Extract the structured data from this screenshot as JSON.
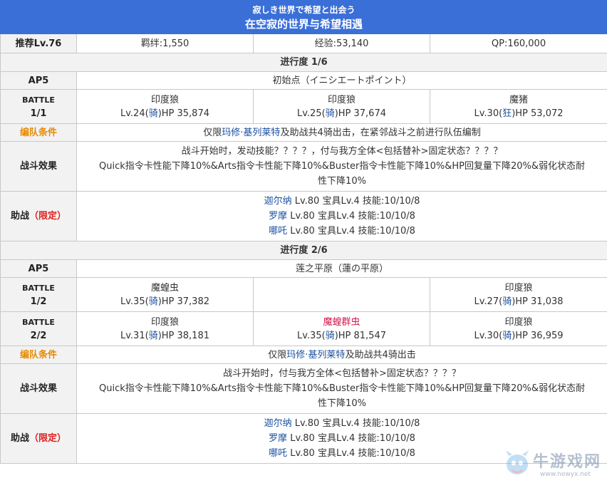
{
  "header": {
    "jp_title": "寂しき世界で希望と出会う",
    "cn_title": "在空寂的世界与希望相遇"
  },
  "summary": {
    "level": "推荐Lv.76",
    "bond": "羁绊:1,550",
    "exp": "经验:53,140",
    "qp": "QP:160,000"
  },
  "sections": [
    {
      "progress": "进行度 1/6",
      "ap": "AP5",
      "location": "初始点（イニシエートポイント）",
      "battles": [
        {
          "label1": "BATTLE",
          "label2": "1/1",
          "enemies": [
            {
              "name": "印度狼",
              "lv": "Lv.24(",
              "cls": "骑",
              "hp": ")HP 35,874"
            },
            {
              "name": "印度狼",
              "lv": "Lv.25(",
              "cls": "骑",
              "hp": ")HP 37,674"
            },
            {
              "name": "魔猪",
              "lv": "Lv.30(",
              "cls": "狂",
              "hp": ")HP 53,072"
            }
          ]
        }
      ],
      "formation": {
        "label": "编队条件",
        "pre": "仅限",
        "servant": "玛修·基列莱特",
        "post": "及助战共4骑出击，在紧邻战斗之前进行队伍编制"
      },
      "effect": {
        "label": "战斗效果",
        "line1": "战斗开始时，发动技能？？？？，付与我方全体<包括替补>固定状态？？？？",
        "line2": "Quick指令卡性能下降10%&Arts指令卡性能下降10%&Buster指令卡性能下降10%&HP回复量下降20%&弱化状态耐",
        "line3": "性下降10%"
      },
      "support": {
        "label": "助战",
        "tag": "（限定）",
        "items": [
          {
            "name": "迦尔纳",
            "info": " Lv.80 宝具Lv.4 技能:10/10/8"
          },
          {
            "name": "罗摩",
            "info": " Lv.80 宝具Lv.4 技能:10/10/8"
          },
          {
            "name": "哪吒",
            "info": " Lv.80 宝具Lv.4 技能:10/10/8"
          }
        ]
      }
    },
    {
      "progress": "进行度 2/6",
      "ap": "AP5",
      "location": "莲之平原（蓮の平原）",
      "battles": [
        {
          "label1": "BATTLE",
          "label2": "1/2",
          "enemies": [
            {
              "name": "魔蝗虫",
              "lv": "Lv.35(",
              "cls": "骑",
              "hp": ")HP 37,382"
            },
            {
              "name": "",
              "lv": "",
              "cls": "",
              "hp": ""
            },
            {
              "name": "印度狼",
              "lv": "Lv.27(",
              "cls": "骑",
              "hp": ")HP 31,038"
            }
          ]
        },
        {
          "label1": "BATTLE",
          "label2": "2/2",
          "enemies": [
            {
              "name": "印度狼",
              "lv": "Lv.31(",
              "cls": "骑",
              "hp": ")HP 38,181"
            },
            {
              "name": "魔蝗群虫",
              "lv": "Lv.35(",
              "cls": "骑",
              "hp": ")HP 81,547"
            },
            {
              "name": "印度狼",
              "lv": "Lv.30(",
              "cls": "骑",
              "hp": ")HP 36,959"
            }
          ]
        }
      ],
      "formation": {
        "label": "编队条件",
        "pre": "仅限",
        "servant": "玛修·基列莱特",
        "post": "及助战共4骑出击"
      },
      "effect": {
        "label": "战斗效果",
        "line1": "战斗开始时，付与我方全体<包括替补>固定状态？？？？",
        "line2": "Quick指令卡性能下降10%&Arts指令卡性能下降10%&Buster指令卡性能下降10%&HP回复量下降20%&弱化状态耐",
        "line3": "性下降10%"
      },
      "support": {
        "label": "助战",
        "tag": "（限定）",
        "items": [
          {
            "name": "迦尔纳",
            "info": " Lv.80 宝具Lv.4 技能:10/10/8"
          },
          {
            "name": "罗摩",
            "info": " Lv.80 宝具Lv.4 技能:10/10/8"
          },
          {
            "name": "哪吒",
            "info": " Lv.80 宝具Lv.4 技能:10/10/8"
          }
        ]
      }
    }
  ],
  "watermark": {
    "site": "牛游戏网",
    "url": "www.newyx.net"
  },
  "colors": {
    "header_bg": "#3a6fd8",
    "label_bg": "#f2f2f2",
    "orange": "#e88a00",
    "red": "#e02020",
    "link_blue": "#1a4fa0",
    "pink": "#d4184a"
  }
}
